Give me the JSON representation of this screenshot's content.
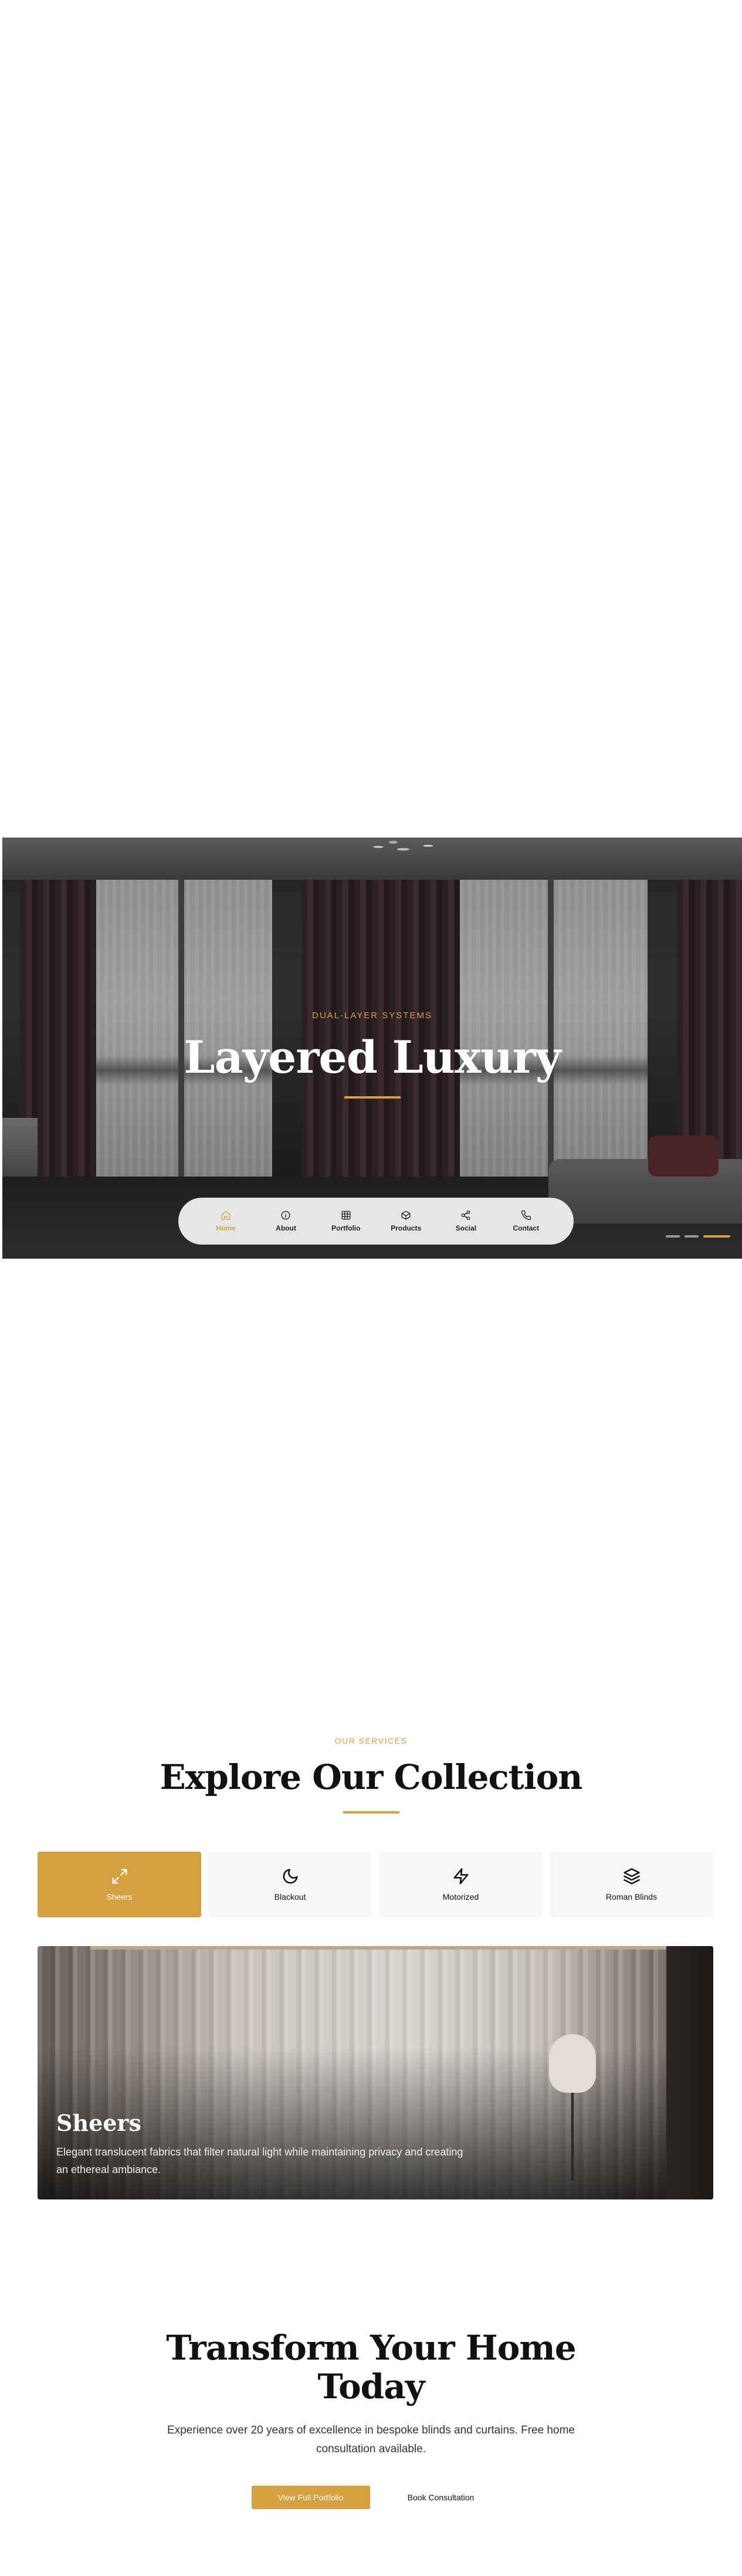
{
  "hero": {
    "eyebrow": "DUAL-LAYER SYSTEMS",
    "title": "Layered Luxury",
    "slide_count": 3,
    "active_slide": 3
  },
  "nav": {
    "active": "Home",
    "items": [
      {
        "label": "Home",
        "icon": "home-icon"
      },
      {
        "label": "About",
        "icon": "info-icon"
      },
      {
        "label": "Portfolio",
        "icon": "grid-icon"
      },
      {
        "label": "Products",
        "icon": "box-icon"
      },
      {
        "label": "Social",
        "icon": "share-icon"
      },
      {
        "label": "Contact",
        "icon": "phone-icon"
      }
    ]
  },
  "services": {
    "eyebrow": "OUR SERVICES",
    "title": "Explore Our Collection",
    "active_tab": "Sheers",
    "tabs": [
      {
        "label": "Sheers",
        "icon": "expand-arrows-icon"
      },
      {
        "label": "Blackout",
        "icon": "moon-icon"
      },
      {
        "label": "Motorized",
        "icon": "lightning-icon"
      },
      {
        "label": "Roman Blinds",
        "icon": "layers-icon"
      }
    ],
    "card": {
      "title": "Sheers",
      "description": "Elegant translucent fabrics that filter natural light while maintaining privacy and creating an ethereal ambiance."
    }
  },
  "cta": {
    "title": "Transform Your Home Today",
    "description": "Experience over 20 years of excellence in bespoke blinds and curtains. Free home consultation available.",
    "primary_button": "View Full Portfolio",
    "secondary_button": "Book Consultation"
  },
  "colors": {
    "accent": "#d4a040",
    "text": "#111111",
    "nav_background": "#e6e6e6",
    "tab_background": "#f7f7f7"
  }
}
